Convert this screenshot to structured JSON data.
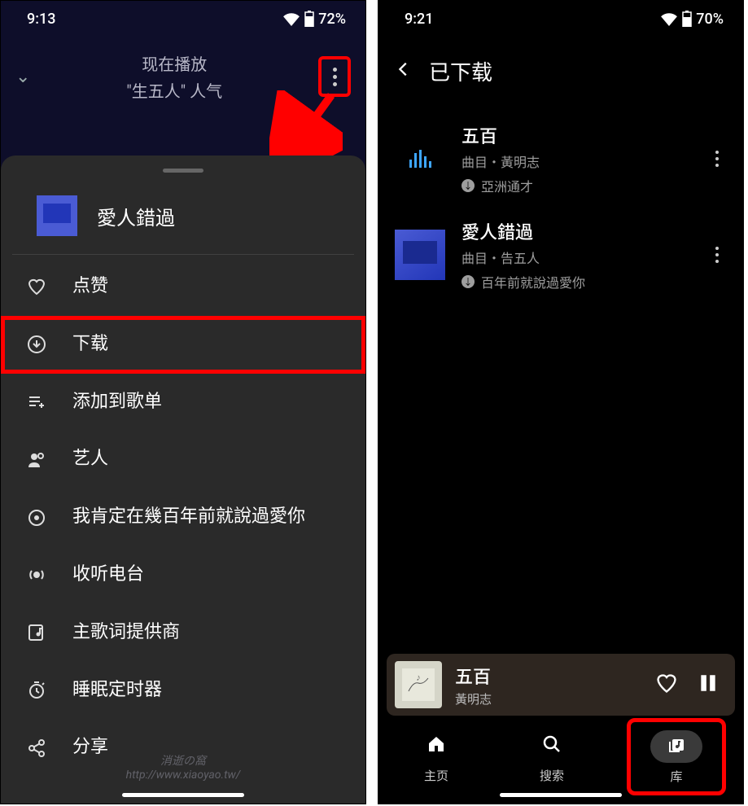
{
  "left": {
    "statusbar": {
      "time": "9:13",
      "battery": "72%"
    },
    "nowplaying": {
      "line1": "现在播放",
      "line2": "\"生五人\" 人气"
    },
    "sheet": {
      "title": "愛人錯過",
      "items": [
        {
          "icon": "heart",
          "label": "点赞"
        },
        {
          "icon": "download",
          "label": "下载",
          "highlight": true
        },
        {
          "icon": "playlist-add",
          "label": "添加到歌单"
        },
        {
          "icon": "artist",
          "label": "艺人"
        },
        {
          "icon": "album",
          "label": "我肯定在幾百年前就說過愛你"
        },
        {
          "icon": "radio",
          "label": "收听电台"
        },
        {
          "icon": "lyrics",
          "label": "主歌词提供商"
        },
        {
          "icon": "timer",
          "label": "睡眠定时器"
        },
        {
          "icon": "share",
          "label": "分享"
        }
      ]
    },
    "watermark": {
      "l1": "消逝の窩",
      "l2": "http://www.xiaoyao.tw/"
    }
  },
  "right": {
    "statusbar": {
      "time": "9:21",
      "battery": "70%"
    },
    "header": {
      "title": "已下载"
    },
    "tracks": [
      {
        "title": "五百",
        "subtitle": "曲目・黃明志",
        "album": "亞洲通才",
        "playing": true
      },
      {
        "title": "愛人錯過",
        "subtitle": "曲目・告五人",
        "album": "百年前就說過愛你",
        "playing": false
      }
    ],
    "miniplayer": {
      "title": "五百",
      "artist": "黃明志"
    },
    "nav": {
      "home": "主页",
      "search": "搜索",
      "library": "库"
    }
  }
}
